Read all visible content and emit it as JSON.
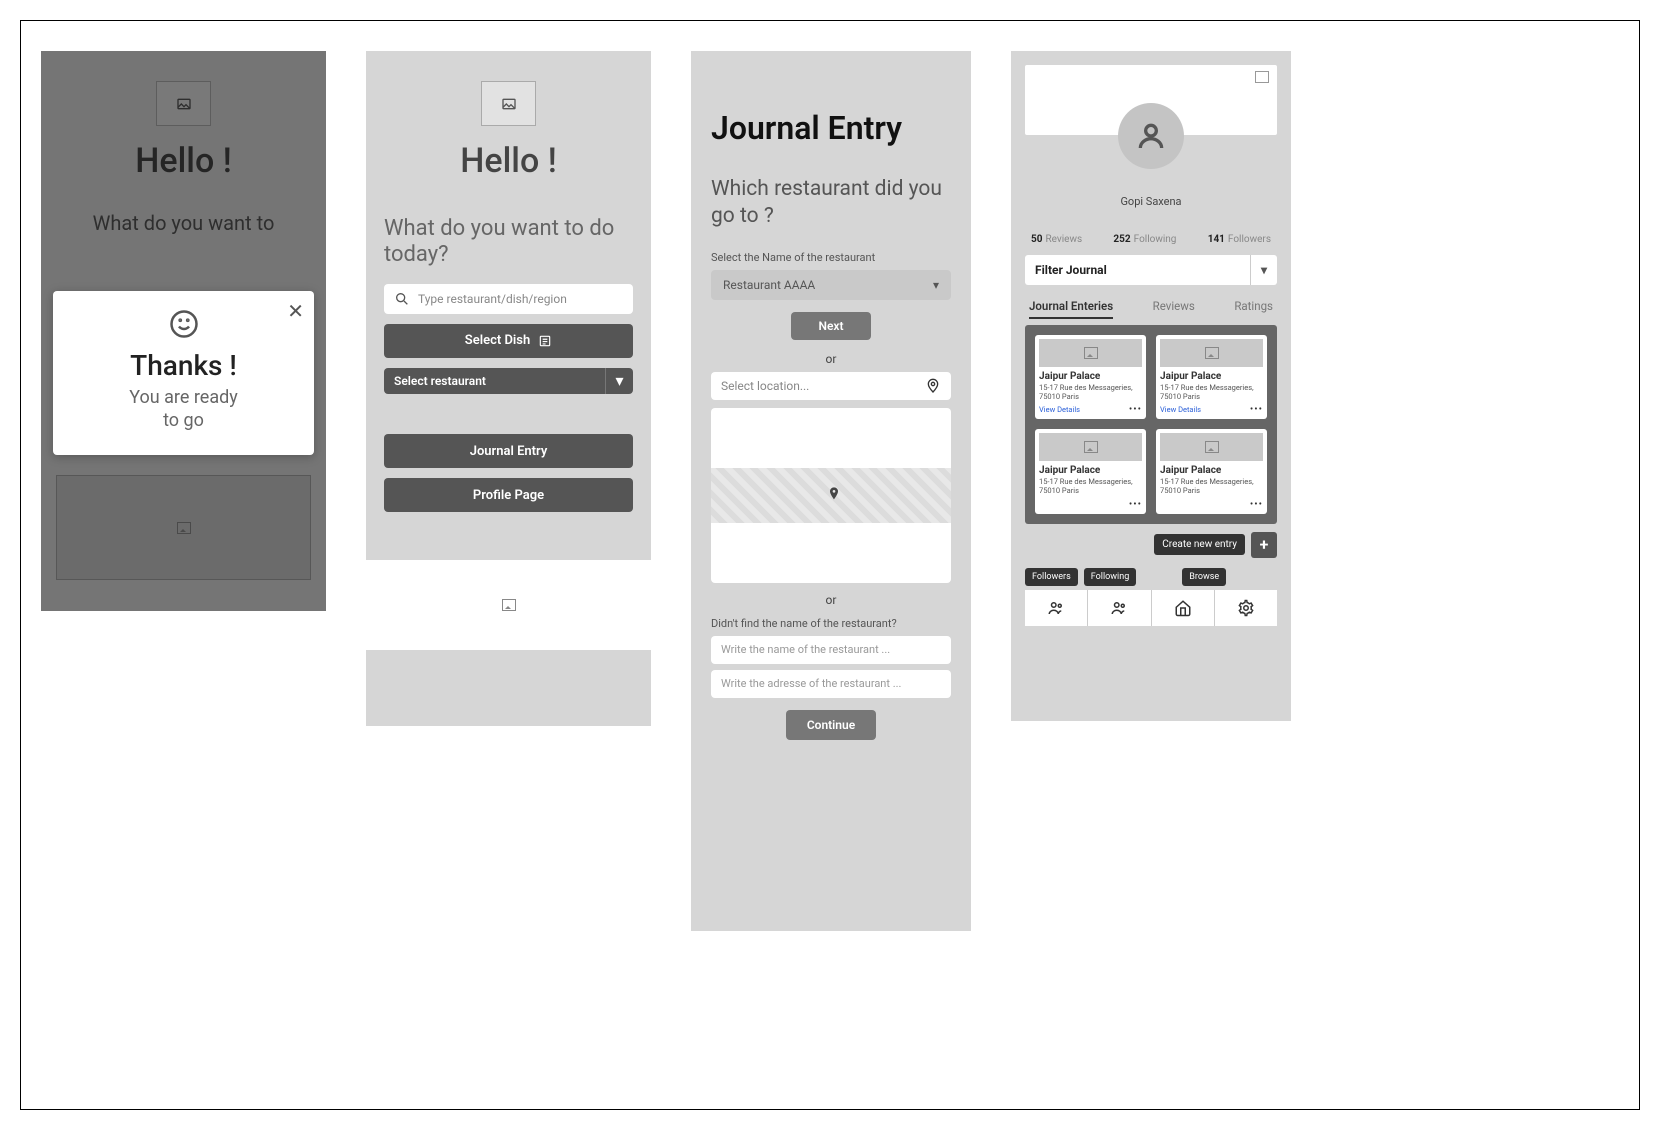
{
  "s1": {
    "hello": "Hello !",
    "sub": "What do you want to",
    "modal": {
      "thanks": "Thanks !",
      "ready1": "You are ready",
      "ready2": "to go"
    }
  },
  "s2": {
    "hello": "Hello !",
    "sub": "What do you want to do today?",
    "search_placeholder": "Type restaurant/dish/region",
    "select_dish": "Select Dish",
    "select_restaurant": "Select restaurant",
    "journal_entry": "Journal Entry",
    "profile_page": "Profile Page"
  },
  "s3": {
    "title": "Journal Entry",
    "question": "Which restaurant did you go to ?",
    "select_label": "Select the Name of the restaurant",
    "dropdown_value": "Restaurant AAAA",
    "next": "Next",
    "or": "or",
    "location_placeholder": "Select location...",
    "hint": "Didn't find the name of the restaurant?",
    "name_placeholder": "Write the name of the restaurant ...",
    "address_placeholder": "Write the adresse of the restaurant ...",
    "continue": "Continue"
  },
  "s4": {
    "username": "Gopi Saxena",
    "stats": {
      "reviews_n": "50",
      "reviews_l": "Reviews",
      "following_n": "252",
      "following_l": "Following",
      "followers_n": "141",
      "followers_l": "Followers"
    },
    "filter": "Filter Journal",
    "tabs": {
      "t1": "Journal Enteries",
      "t2": "Reviews",
      "t3": "Ratings"
    },
    "card": {
      "name": "Jaipur Palace",
      "addr": "15-17 Rue des Messageries, 75010 Paris",
      "view": "View Details"
    },
    "create": "Create new entry",
    "tooltips": {
      "t1": "Followers",
      "t2": "Following",
      "t3": "Browse"
    }
  }
}
